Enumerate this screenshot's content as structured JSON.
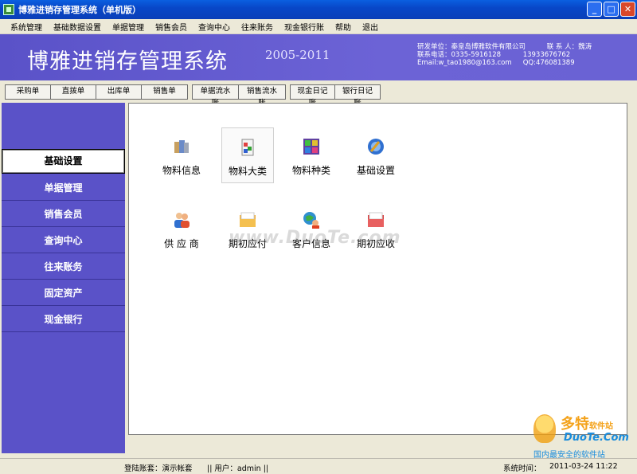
{
  "window": {
    "title": "博雅进销存管理系统（单机版）",
    "controls": {
      "minimize": "_",
      "maximize": "□",
      "close": "✕"
    }
  },
  "menu": [
    "系统管理",
    "基础数据设置",
    "单据管理",
    "销售会员",
    "查询中心",
    "往来账务",
    "现金银行账",
    "帮助",
    "退出"
  ],
  "banner": {
    "title": "博雅进销存管理系统",
    "years": "2005-2011",
    "developer": "研发单位：秦皇岛博雅软件有限公司",
    "contact_label": "联 系 人：魏涛",
    "phone": "联系电话：0335-5916128",
    "mobile": "13933676762",
    "email": "Email:w_tao1980@163.com",
    "qq": "QQ:476081389"
  },
  "toolbar": {
    "group1": [
      "采购单",
      "直拨单",
      "出库单",
      "销售单"
    ],
    "group2": [
      "单据流水账",
      "销售流水账"
    ],
    "group3": [
      "现金日记账",
      "银行日记账"
    ]
  },
  "sidebar": {
    "items": [
      "基础设置",
      "单据管理",
      "销售会员",
      "查询中心",
      "往来账务",
      "固定资产",
      "现金银行"
    ],
    "active_index": 0
  },
  "content": {
    "icons": [
      {
        "label": "物料信息",
        "icon": "material-info-icon"
      },
      {
        "label": "物料大类",
        "icon": "material-category-icon"
      },
      {
        "label": "物料种类",
        "icon": "material-type-icon"
      },
      {
        "label": "基础设置",
        "icon": "basic-settings-icon"
      },
      {
        "label": "供 应 商",
        "icon": "supplier-icon"
      },
      {
        "label": "期初应付",
        "icon": "opening-payable-icon"
      },
      {
        "label": "客户信息",
        "icon": "customer-info-icon"
      },
      {
        "label": "期初应收",
        "icon": "opening-receivable-icon"
      }
    ],
    "selected_index": 1,
    "watermark": "www.DuoTe.com"
  },
  "status": {
    "account": "登陆账套：演示帐套",
    "user": "|| 用户：admin  ||",
    "time_label": "系统时间：",
    "time": "2011-03-24 11:22"
  },
  "corner_logo": {
    "brand": "多特",
    "brand_suffix": "软件站",
    "site": "DuoTe.Com",
    "slogan": "国内最安全的软件站"
  },
  "colors": {
    "sidebar": "#5a52c8",
    "banner": "#6c63d6",
    "titlebar": "#0847c8"
  }
}
